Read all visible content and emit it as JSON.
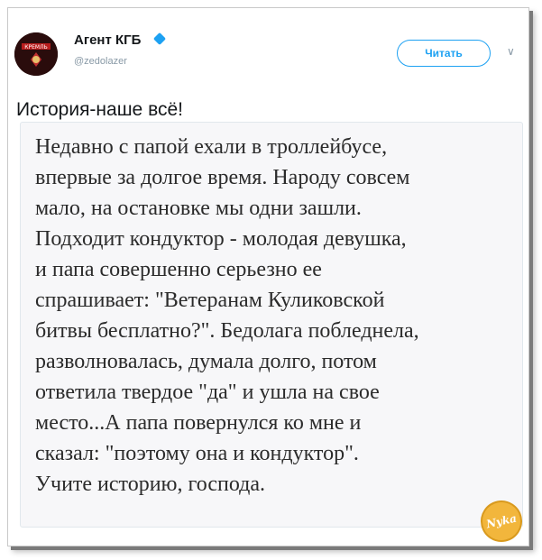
{
  "tweet": {
    "author_name": "Агент КГБ",
    "handle": "@zedolazer",
    "follow_label": "Читать",
    "text": "История-наше всё!",
    "avatar_text": "КРЕМЛЬ"
  },
  "card": {
    "lines": [
      "Недавно с папой ехали в троллейбусе,",
      "впервые за долгое время. Народу совсем",
      "мало, на остановке мы одни зашли.",
      "Подходит кондуктор - молодая девушка,",
      "и папа совершенно серьезно ее",
      "спрашивает: \"Ветеранам Куликовской",
      "битвы бесплатно?\". Бедолага побледнела,",
      "разволновалась, думала долго, потом",
      "ответила твердое \"да\" и ушла на свое",
      "место...А папа повернулся ко мне и",
      "сказал: \"поэтому она и кондуктор\".",
      "Учите историю, господа."
    ]
  },
  "watermark": {
    "text": "Nyka"
  },
  "colors": {
    "accent": "#1da1f2",
    "muted": "#8899a6",
    "text": "#14171a"
  },
  "icons": {
    "verified": "verified-badge-icon",
    "more": "chevron-down-icon"
  }
}
